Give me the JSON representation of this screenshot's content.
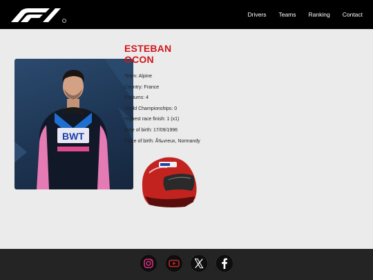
{
  "nav": {
    "logo_name": "f1-logo",
    "links": [
      "Drivers",
      "Teams",
      "Ranking",
      "Contact"
    ]
  },
  "driver": {
    "first_name": "ESTEBAN",
    "last_name": "OCON",
    "stats": [
      "Team: Alpine",
      "Country: France",
      "Podiums: 4",
      "World Championships: 0",
      "Highest race finish: 1 (x1)",
      "Date of birth: 17/09/1996",
      "Place of birth: Ã‰vreux, Normandy"
    ]
  },
  "footer": {
    "icons": [
      "instagram-icon",
      "youtube-icon",
      "x-icon",
      "facebook-icon"
    ]
  },
  "colors": {
    "header": "#000000",
    "accent": "#d1151b",
    "footer": "#242424",
    "background": "#ebebeb"
  }
}
